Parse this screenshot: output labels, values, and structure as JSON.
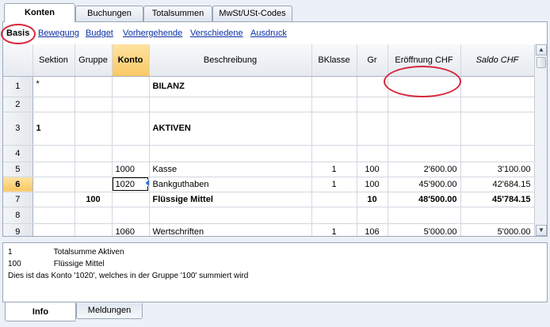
{
  "tabs_top": [
    {
      "label": "Konten",
      "active": true
    },
    {
      "label": "Buchungen",
      "active": false
    },
    {
      "label": "Totalsummen",
      "active": false
    },
    {
      "label": "MwSt/USt-Codes",
      "active": false
    }
  ],
  "subnav": [
    {
      "label": "Basis",
      "active": true
    },
    {
      "label": "Bewegung",
      "active": false
    },
    {
      "label": "Budget",
      "active": false
    },
    {
      "label": "Vorhergehende",
      "active": false
    },
    {
      "label": "Verschiedene",
      "active": false
    },
    {
      "label": "Ausdruck",
      "active": false
    }
  ],
  "columns": {
    "sektion": "Sektion",
    "gruppe": "Gruppe",
    "konto": "Konto",
    "beschreibung": "Beschreibung",
    "bklasse": "BKlasse",
    "gr": "Gr",
    "eroeffnung": "Eröffnung CHF",
    "saldo": "Saldo CHF"
  },
  "rows": [
    {
      "n": "1",
      "sektion": "*",
      "gruppe": "",
      "konto": "",
      "beschreibung": "BILANZ",
      "bklasse": "",
      "gr": "",
      "eroeffnung": "",
      "saldo": ""
    },
    {
      "n": "2",
      "sektion": "",
      "gruppe": "",
      "konto": "",
      "beschreibung": "",
      "bklasse": "",
      "gr": "",
      "eroeffnung": "",
      "saldo": ""
    },
    {
      "n": "3",
      "sektion": "1",
      "gruppe": "",
      "konto": "",
      "beschreibung": "AKTIVEN",
      "bklasse": "",
      "gr": "",
      "eroeffnung": "",
      "saldo": ""
    },
    {
      "n": "4",
      "sektion": "",
      "gruppe": "",
      "konto": "",
      "beschreibung": "",
      "bklasse": "",
      "gr": "",
      "eroeffnung": "",
      "saldo": ""
    },
    {
      "n": "5",
      "sektion": "",
      "gruppe": "",
      "konto": "1000",
      "beschreibung": "Kasse",
      "bklasse": "1",
      "gr": "100",
      "eroeffnung": "2'600.00",
      "saldo": "3'100.00"
    },
    {
      "n": "6",
      "sektion": "",
      "gruppe": "",
      "konto": "1020",
      "beschreibung": "Bankguthaben",
      "bklasse": "1",
      "gr": "100",
      "eroeffnung": "45'900.00",
      "saldo": "42'684.15"
    },
    {
      "n": "7",
      "sektion": "",
      "gruppe": "100",
      "konto": "",
      "beschreibung": "Flüssige Mittel",
      "bklasse": "",
      "gr": "10",
      "eroeffnung": "48'500.00",
      "saldo": "45'784.15"
    },
    {
      "n": "8",
      "sektion": "",
      "gruppe": "",
      "konto": "",
      "beschreibung": "",
      "bklasse": "",
      "gr": "",
      "eroeffnung": "",
      "saldo": ""
    },
    {
      "n": "9",
      "sektion": "",
      "gruppe": "",
      "konto": "1060",
      "beschreibung": "Wertschriften",
      "bklasse": "1",
      "gr": "106",
      "eroeffnung": "5'000.00",
      "saldo": "5'000.00"
    }
  ],
  "info": {
    "lines": [
      {
        "c1": "1",
        "c2": "Totalsumme Aktiven"
      },
      {
        "c1": "100",
        "c2": "Flüssige Mittel"
      }
    ],
    "message": "Dies ist das Konto '1020', welches in der Gruppe '100' summiert wird"
  },
  "tabs_bottom": [
    {
      "label": "Info",
      "active": true
    },
    {
      "label": "Meldungen",
      "active": false
    }
  ],
  "colors": {
    "selected_col": "#f8c865",
    "highlight_circle": "#d8263b",
    "link": "#0b2fa6"
  }
}
